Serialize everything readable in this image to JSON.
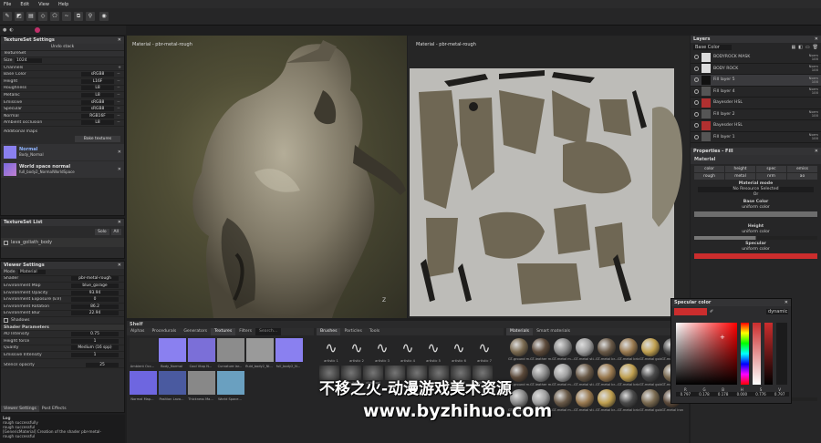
{
  "menu": [
    "File",
    "Edit",
    "View",
    "Help"
  ],
  "textureset_settings": {
    "title": "TextureSet Settings",
    "undo_label": "Undo stack",
    "textureset_label": "TextureSet",
    "size_label": "Size",
    "size_value": "1024",
    "channels_label": "Channels",
    "channels": [
      {
        "name": "Base Color",
        "format": "sRGB8"
      },
      {
        "name": "Height",
        "format": "L16F"
      },
      {
        "name": "Roughness",
        "format": "L8"
      },
      {
        "name": "Metallic",
        "format": "L8"
      },
      {
        "name": "Emissive",
        "format": "sRGB8"
      },
      {
        "name": "Specular",
        "format": "sRGB8"
      },
      {
        "name": "Normal",
        "format": "RGB16F"
      },
      {
        "name": "Ambient occlusion",
        "format": "L8"
      }
    ],
    "additional_maps": "Additional maps",
    "bake_button": "Bake textures",
    "maps": [
      {
        "title": "Normal",
        "sub": "Body_Normal"
      },
      {
        "title": "World space normal",
        "sub": "full_body2_NormalWorldSpace"
      }
    ]
  },
  "textureset_list": {
    "title": "TextureSet List",
    "solo": "Solo",
    "all": "All",
    "item": "lava_goliath_body"
  },
  "viewer_settings": {
    "title": "Viewer Settings",
    "mode": "Mode",
    "mode_value": "Material",
    "rows": [
      {
        "label": "Shader",
        "value": "pbr-metal-rough"
      },
      {
        "label": "Environment Map",
        "value": "blue_garage"
      },
      {
        "label": "Environment Opacity",
        "value": "93.94"
      },
      {
        "label": "Environment Exposure (EV)",
        "value": "0"
      },
      {
        "label": "Environment Rotation",
        "value": "86.2"
      },
      {
        "label": "Environment Blur",
        "value": "22.94"
      }
    ],
    "shadows": "Shadows",
    "shader_params": "Shader Parameters",
    "params": [
      {
        "label": "AO Intensity",
        "value": "0.75"
      },
      {
        "label": "Height force",
        "value": "1"
      },
      {
        "label": "Quality",
        "value": "Medium (16 spp)"
      },
      {
        "label": "Emissive Intensity",
        "value": "1"
      }
    ],
    "stencil": "Stencil opacity",
    "stencil_value": "25",
    "tabs": [
      "Viewer Settings",
      "Post Effects"
    ]
  },
  "log": {
    "title": "Log",
    "lines": [
      "rough successfully",
      "rough successful",
      "[GenericMaterial] Creation of the shader pbr-metal-",
      "rough successful"
    ]
  },
  "viewport_left": {
    "label": "Material - pbr-metal-rough"
  },
  "viewport_right": {
    "label": "Material - pbr-metal-rough"
  },
  "shelf": {
    "title": "Shelf",
    "tabs": [
      "Alphas",
      "Procedurals",
      "Generators",
      "Textures",
      "Filters"
    ],
    "search": "Search...",
    "thumb_captions": [
      "Ambient Occ...",
      "Body_Normal",
      "Cool Vtop N...",
      "Curvature lar...",
      "fluid_body2_Ni...",
      "full_body2_N...",
      "Normal Map...",
      "Position Lava...",
      "Thickness Ma...",
      "World Space..."
    ],
    "brush_tabs": [
      "Brushes",
      "Particles",
      "Tools"
    ],
    "brush_captions": [
      "artistic 1",
      "artistic 2",
      "artistic 3",
      "artistic 4",
      "artistic 5",
      "artistic 6",
      "artistic 7"
    ],
    "brush_captions2": [
      "basic",
      "basic_hard",
      "charcoal",
      "chalk",
      "dirt 1",
      "dirt 2",
      "dirt 3",
      "dirt 4"
    ],
    "material_tabs": [
      "Materials",
      "Smart materials"
    ],
    "mat_captions": [
      "GT-ground m...",
      "GT-leather m...",
      "GT-metal m...",
      "GT-metal sti...",
      "GT-metal br...",
      "GT-metal bric...",
      "GT-metal gold...",
      "GT-metal iron..."
    ]
  },
  "layers": {
    "title": "Layers",
    "channel": "Base Color",
    "items": [
      {
        "name": "BODYROCK MASK",
        "blend": "Norm",
        "opacity": "100"
      },
      {
        "name": "BODY ROCK",
        "blend": "Norm",
        "opacity": "100"
      },
      {
        "name": "Fill layer 5",
        "blend": "Norm",
        "opacity": "100"
      },
      {
        "name": "Fill layer 4",
        "blend": "Norm",
        "opacity": "100"
      },
      {
        "name": "Bayesder HSL",
        "blend": "",
        "opacity": ""
      },
      {
        "name": "Fill layer 2",
        "blend": "Norm",
        "opacity": "100"
      },
      {
        "name": "Bayesder HSL",
        "blend": "",
        "opacity": ""
      },
      {
        "name": "Fill layer 1",
        "blend": "Norm",
        "opacity": "100"
      }
    ]
  },
  "properties": {
    "title": "Properties - Fill",
    "section": "Material",
    "channels_row1": [
      "color",
      "height",
      "spec",
      "emiss"
    ],
    "channels_row2": [
      "rough",
      "metal",
      "nrm",
      "ao"
    ],
    "material_mode": "Material mode",
    "no_resource": "No Resource Selected",
    "or": "Or",
    "base_color": "Base Color",
    "uniform": "uniform color",
    "height": "Height",
    "specular": "Specular",
    "ambient": "Ambient occlusion"
  },
  "color_picker": {
    "title": "Specular color",
    "mode": "dynamic",
    "r": "0.797",
    "g": "0.178",
    "b": "0.178",
    "h": "0.000",
    "s": "0.776",
    "v": "0.797",
    "labels": [
      "R",
      "G",
      "B",
      "H",
      "S",
      "V"
    ]
  },
  "watermark": {
    "line1": "不移之火-动漫游戏美术资源",
    "line2": "www.byzhihuo.com"
  },
  "colors": {
    "accent": "#d63a3a",
    "panel": "#2a2a2b",
    "picker_red": "#cb2d2d"
  }
}
